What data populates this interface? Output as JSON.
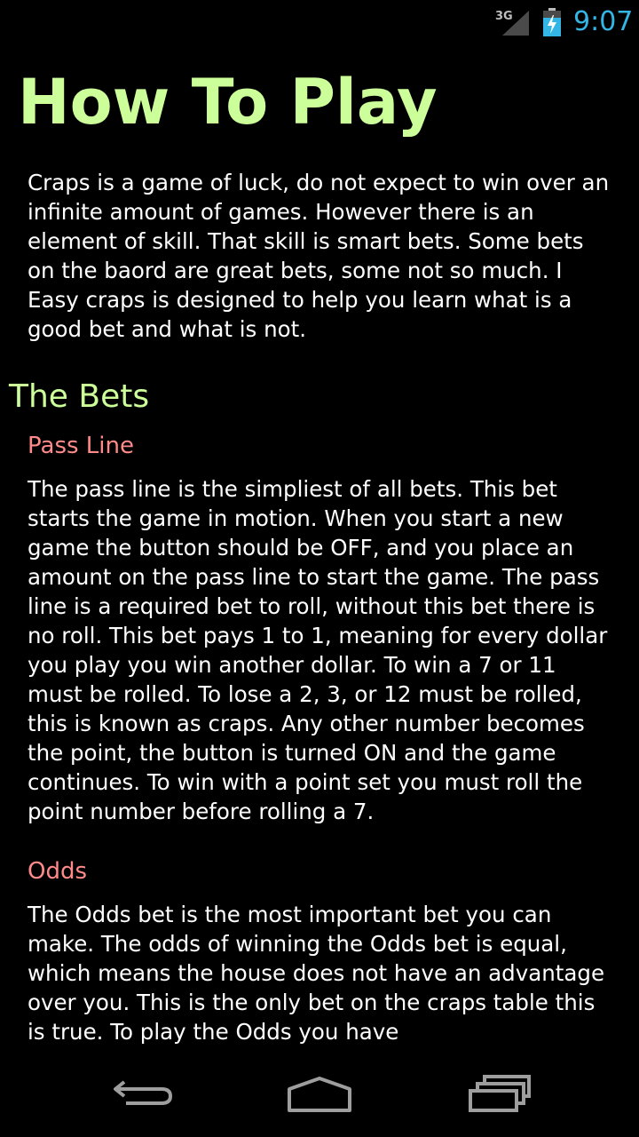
{
  "status_bar": {
    "network_type": "3G",
    "time": "9:07",
    "accent_color": "#33b5e5"
  },
  "page": {
    "title": "How To Play",
    "intro": "Craps is a game of luck, do not expect to win over an infinite amount of games. However there is an element of skill. That skill is smart bets. Some bets on the baord are great bets, some not so much. I Easy craps is designed to help you learn what is a good bet and what is not.",
    "section_title": "The Bets",
    "bets": [
      {
        "heading": "Pass Line",
        "body": "The pass line is the simpliest of all bets. This bet starts the game in motion. When you start a new game the button should be OFF, and you place an amount on the pass line to start the game. The pass line is a required bet to roll, without this bet there is no roll. This bet pays 1 to 1, meaning for every dollar you play you win another dollar. To win a 7 or 11 must be rolled. To lose a 2, 3, or 12 must be rolled, this is known as craps. Any other number becomes the point, the button is turned ON and the game continues. To win with a point set you must roll the point number before rolling a 7."
      },
      {
        "heading": "Odds",
        "body": "The Odds bet is the most important bet you can make. The odds of winning the Odds bet is equal, which means the house does not have an advantage over you. This is the only bet on the craps table this is true. To play the Odds you have"
      }
    ]
  },
  "colors": {
    "title_green": "#ccff99",
    "heading_pink": "#ff8a8a",
    "background": "#000000",
    "text": "#ffffff"
  },
  "nav_bar": {
    "icons": [
      "back-icon",
      "home-icon",
      "recent-apps-icon"
    ]
  }
}
